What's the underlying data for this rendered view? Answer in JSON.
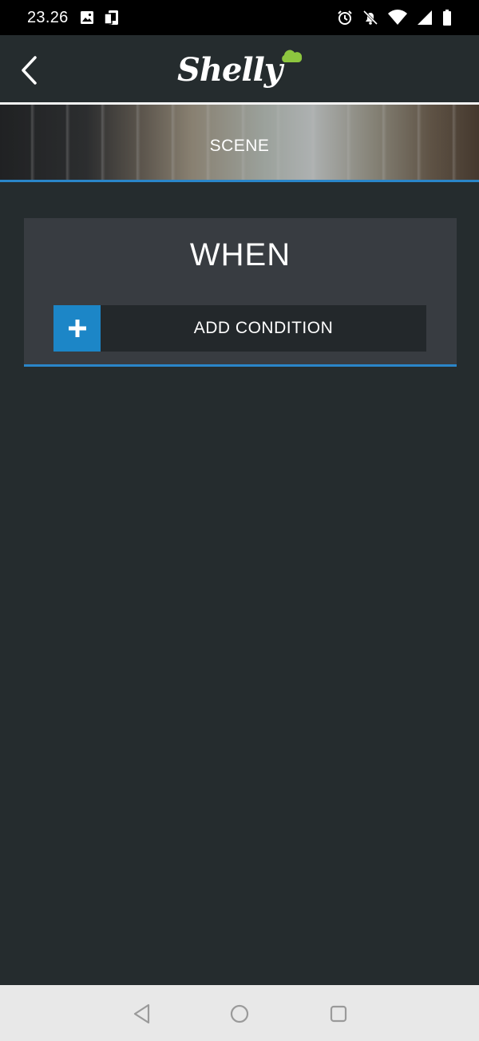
{
  "status_bar": {
    "time": "23.26",
    "icons_left": [
      "image-icon",
      "device-icon"
    ],
    "icons_right": [
      "alarm-icon",
      "notifications-off-icon",
      "wifi-icon",
      "signal-icon",
      "battery-icon"
    ]
  },
  "header": {
    "back_icon": "chevron-left-icon",
    "logo_text": "Shelly"
  },
  "banner": {
    "title": "SCENE"
  },
  "when_card": {
    "title": "WHEN",
    "add_condition_label": "ADD CONDITION",
    "add_icon": "plus-icon"
  },
  "nav_bar": {
    "buttons": [
      "back-triangle-icon",
      "home-circle-icon",
      "recents-square-icon"
    ]
  },
  "colors": {
    "background": "#252c2e",
    "card": "#383c41",
    "accent_blue": "#1c86c7",
    "logo_green": "#8dc63f",
    "nav_bar": "#e8e8e8"
  }
}
